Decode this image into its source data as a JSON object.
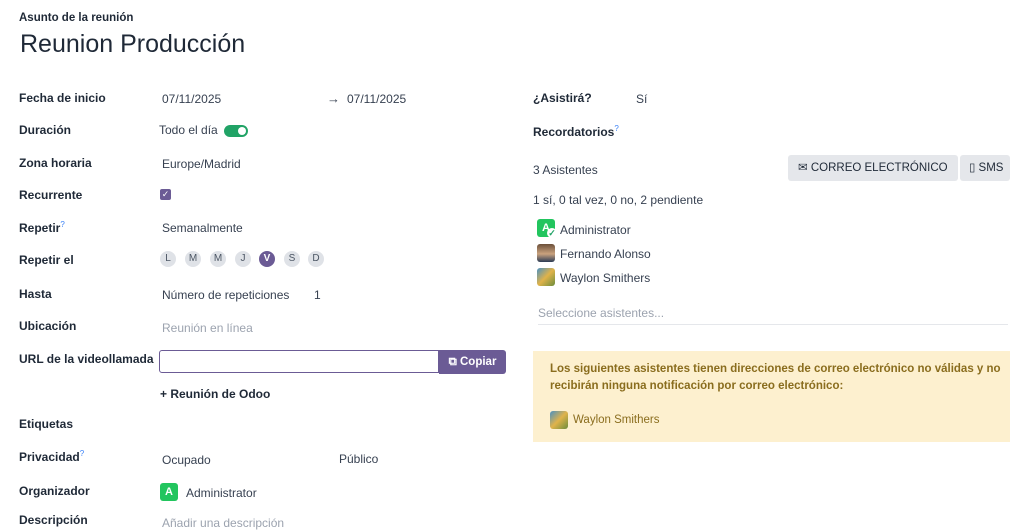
{
  "header": {
    "subject_label": "Asunto de la reunión",
    "subject_value": "Reunion Producción"
  },
  "form": {
    "start_date_label": "Fecha de inicio",
    "start_date": "07/11/2025",
    "arrow": "→",
    "end_date": "07/11/2025",
    "duration_label": "Duración",
    "all_day_text": "Todo el día",
    "all_day_on": true,
    "timezone_label": "Zona horaria",
    "timezone_value": "Europe/Madrid",
    "recurrent_label": "Recurrente",
    "recurrent_checked": true,
    "repeat_label": "Repetir",
    "repeat_help": "?",
    "repeat_value": "Semanalmente",
    "repeat_on_label": "Repetir el",
    "days": [
      {
        "letter": "L",
        "active": false
      },
      {
        "letter": "M",
        "active": false
      },
      {
        "letter": "M",
        "active": false
      },
      {
        "letter": "J",
        "active": false
      },
      {
        "letter": "V",
        "active": true
      },
      {
        "letter": "S",
        "active": false
      },
      {
        "letter": "D",
        "active": false
      }
    ],
    "until_label": "Hasta",
    "until_value": "Número de repeticiones",
    "until_count": "1",
    "location_label": "Ubicación",
    "location_placeholder": "Reunión en línea",
    "video_url_label": "URL de la videollamada",
    "video_url_value": "",
    "copy_button": "Copiar",
    "odoo_meeting_button": "+ Reunión de Odoo",
    "tags_label": "Etiquetas",
    "privacy_label": "Privacidad",
    "privacy_help": "?",
    "privacy_busy": "Ocupado",
    "privacy_public": "Público",
    "organizer_label": "Organizador",
    "organizer_initial": "A",
    "organizer_name": "Administrator",
    "description_label": "Descripción",
    "description_placeholder": "Añadir una descripción"
  },
  "right": {
    "attend_label": "¿Asistirá?",
    "attend_value": "Sí",
    "reminders_label": "Recordatorios",
    "reminders_help": "?",
    "attendees_count": "3 Asistentes",
    "email_button": "CORREO ELECTRÓNICO",
    "sms_button": "SMS",
    "attendees_summary": "1 sí, 0 tal vez, 0 no, 2 pendiente",
    "attendees": [
      {
        "name": "Administrator",
        "initial": "A"
      },
      {
        "name": "Fernando Alonso"
      },
      {
        "name": "Waylon Smithers"
      }
    ],
    "select_attendees_placeholder": "Seleccione asistentes...",
    "warning_text": "Los siguientes asistentes tienen direcciones de correo electrónico no válidas y no recibirán ninguna notificación por correo electrónico:",
    "warning_attendee": "Waylon Smithers"
  },
  "colors": {
    "accent": "#6b5b95",
    "toggle_on": "#21a366",
    "warning_bg": "#fdf0cf",
    "warning_text": "#8a6d1e"
  }
}
